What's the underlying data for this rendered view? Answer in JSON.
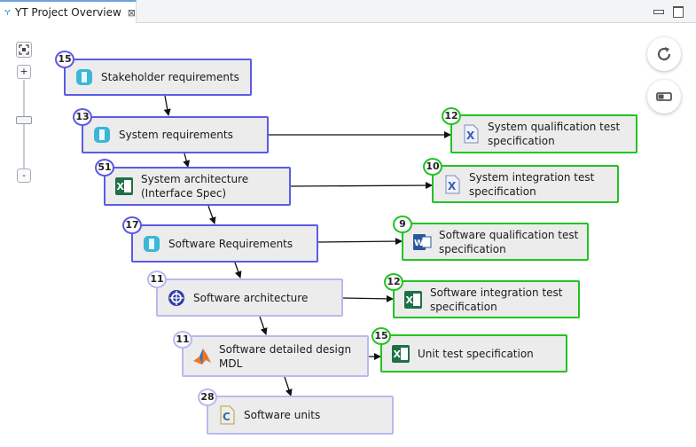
{
  "tab": {
    "title": "YT Project Overview",
    "close": "⊠"
  },
  "zoom": {
    "plus": "+",
    "minus": "-",
    "level": 0.45
  },
  "colors": {
    "blue_border": "#5b5be6",
    "green_border": "#22c322",
    "faded_border": "#b9b9f0",
    "node_fill": "#ececec"
  },
  "nodes": [
    {
      "label": "Stakeholder requirements",
      "count": "15",
      "icon": "requirements-doc-icon"
    },
    {
      "label": "System requirements",
      "count": "13",
      "icon": "requirements-doc-icon"
    },
    {
      "label": "System architecture\n(Interface Spec)",
      "count": "51",
      "icon": "excel-icon"
    },
    {
      "label": "Software Requirements",
      "count": "17",
      "icon": "requirements-doc-icon"
    },
    {
      "label": "Software architecture",
      "count": "11",
      "icon": "architecture-model-icon"
    },
    {
      "label": "Software detailed design\nMDL",
      "count": "11",
      "icon": "matlab-icon"
    },
    {
      "label": "Software units",
      "count": "28",
      "icon": "c-source-icon"
    },
    {
      "label": "System qualification test\nspecification",
      "count": "12",
      "icon": "test-spec-icon"
    },
    {
      "label": "System integration test\nspecification",
      "count": "10",
      "icon": "test-spec-icon"
    },
    {
      "label": "Software qualification test\nspecification",
      "count": "9",
      "icon": "word-icon"
    },
    {
      "label": "Software integration test\nspecification",
      "count": "12",
      "icon": "excel-icon"
    },
    {
      "label": "Unit test specification",
      "count": "15",
      "icon": "excel-icon"
    }
  ]
}
